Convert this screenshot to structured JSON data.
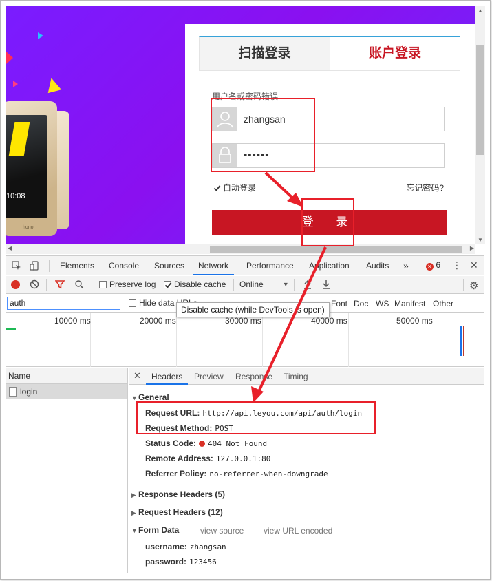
{
  "login_page": {
    "phone_time": "10:08",
    "phone_brand": "honor",
    "tab_scan": "扫描登录",
    "tab_account": "账户登录",
    "error_message": "用户名或密码错误",
    "username_value": "zhangsan",
    "password_value": "••••••",
    "auto_login_label": "自动登录",
    "forgot_password": "忘记密码?",
    "login_button": "登 录",
    "accent_color": "#c81623",
    "banner_color": "#8a10f0"
  },
  "devtools": {
    "tabs": [
      "Elements",
      "Console",
      "Sources",
      "Network",
      "Performance",
      "Application",
      "Audits"
    ],
    "active_tab": "Network",
    "more_tabs": "»",
    "error_count": "6",
    "toolbar": {
      "preserve_log": "Preserve log",
      "disable_cache": "Disable cache",
      "throttle": "Online"
    },
    "filter": {
      "value": "auth",
      "hide_data": "Hide data URLs",
      "types": [
        "Font",
        "Doc",
        "WS",
        "Manifest",
        "Other"
      ]
    },
    "tooltip": "Disable cache (while DevTools is open)",
    "timeline_labels": [
      "10000 ms",
      "20000 ms",
      "30000 ms",
      "40000 ms",
      "50000 ms"
    ],
    "name_header": "Name",
    "requests": [
      "login"
    ],
    "detail_tabs": [
      "Headers",
      "Preview",
      "Response",
      "Timing"
    ],
    "general": {
      "title": "General",
      "request_url_label": "Request URL:",
      "request_url": "http://api.leyou.com/api/auth/login",
      "request_method_label": "Request Method:",
      "request_method": "POST",
      "status_code_label": "Status Code:",
      "status_code": "404 Not Found",
      "remote_address_label": "Remote Address:",
      "remote_address": "127.0.0.1:80",
      "referrer_policy_label": "Referrer Policy:",
      "referrer_policy": "no-referrer-when-downgrade"
    },
    "response_headers": "Response Headers (5)",
    "request_headers": "Request Headers (12)",
    "form_data": {
      "title": "Form Data",
      "view_source": "view source",
      "view_url_encoded": "view URL encoded",
      "username_label": "username:",
      "username": "zhangsan",
      "password_label": "password:",
      "password": "123456"
    }
  },
  "annotation_color": "#e8202a"
}
